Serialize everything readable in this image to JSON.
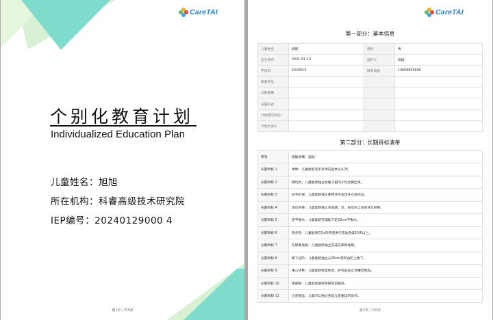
{
  "brand": {
    "name": "CareTAI"
  },
  "cover": {
    "title": "个别化教育计划",
    "subtitle": "Individualized Education Plan",
    "child_name": "儿童姓名：旭旭",
    "institution": "所在机构：科睿高级技术研究院",
    "iep_no": "IEP编号：20240129000 4"
  },
  "footers": {
    "page1": "第1页 / 共6页",
    "page2": "第2页 / 共6页"
  },
  "section1": {
    "title": "第一部分：基本信息",
    "rows": [
      {
        "k1": "儿童姓名",
        "v1": "旭旭",
        "k2": "性别",
        "v2": "男"
      },
      {
        "k1": "出生年月",
        "v1": "2021-01-13",
        "k2": "监护人",
        "v2": "妈妈"
      },
      {
        "k1": "学员ID",
        "v1": "2320013",
        "k2": "联系电话",
        "v2": "13669995808"
      },
      {
        "k1": "家庭住址",
        "v1": "",
        "k2": "",
        "v2": ""
      },
      {
        "k1": "诊断结果",
        "v1": "",
        "k2": "",
        "v2": ""
      },
      {
        "k1": "安置形式",
        "v1": "",
        "k2": "",
        "v2": ""
      },
      {
        "k1": "计划撰写时间",
        "v1": "",
        "k2": "",
        "v2": ""
      },
      {
        "k1": "计划负责人",
        "v1": "",
        "k2": "",
        "v2": ""
      }
    ]
  },
  "section2": {
    "title": "第二部分：长期目标清单",
    "header": {
      "c1": "序号",
      "c2": "技能领域：运动"
    },
    "rows": [
      {
        "c1": "长期目标 1",
        "c2": "举球：儿童能够双手拿球向后举过头顶。"
      },
      {
        "c1": "长期目标 2",
        "c2": "倒玩具：儿童能够独立将瓶子里的小玩具倒出来。"
      },
      {
        "c1": "长期目标 3",
        "c2": "双手扔球：儿童能够独立使用双手拿球并过肩扔出。"
      },
      {
        "c1": "长期目标 4",
        "c2": "体位转换：儿童能够独立完成蹲、走、坐动作之间的体位转换。"
      },
      {
        "c1": "长期目标 5",
        "c2": "走平衡木：儿童能够在辅助下走20cm平衡木。"
      },
      {
        "c1": "长期目标 6",
        "c2": "快步走：儿童能够在5s内快速进行走动连续10步以上。"
      },
      {
        "c1": "长期目标 7",
        "c2": "双脚离地跳：儿童能够独立完成双脚离地跳。"
      },
      {
        "c1": "长期目标 8",
        "c2": "跳下台阶：儿童能够独立从25cm高的台阶上跳下。"
      },
      {
        "c1": "长期目标 9",
        "c2": "重心转移：儿童能够倒退移动，并完成站立弯腰捡物品。"
      },
      {
        "c1": "长期目标 10",
        "c2": "单脚跳：儿童能够使用单脚向前跳跃。"
      },
      {
        "c1": "长期目标 11",
        "c2": "立定跳远：儿童可以独立完成立定跳远的动作。"
      }
    ]
  },
  "colors": {
    "teal": "#7fdccd",
    "light_green": "#d9f1d3",
    "logo_blue": "#2a86c9"
  }
}
